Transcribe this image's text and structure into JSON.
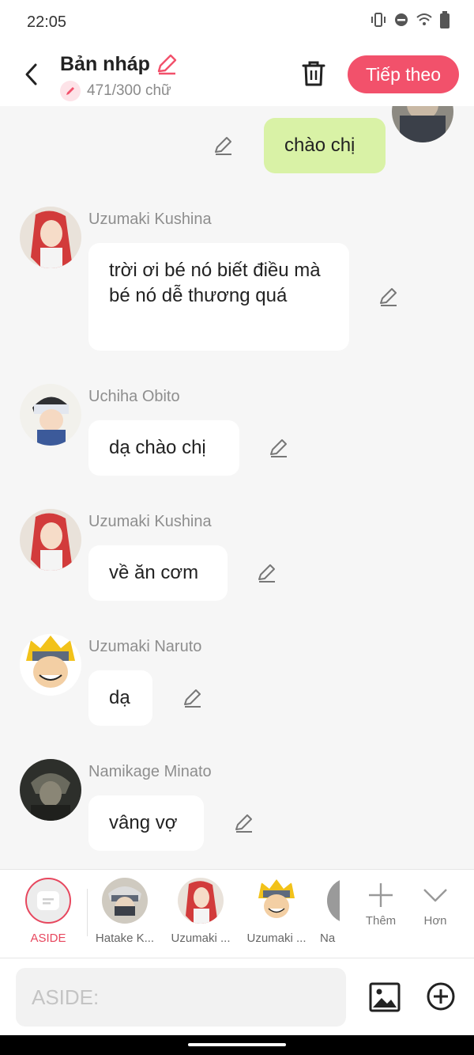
{
  "status": {
    "time": "22:05"
  },
  "header": {
    "title": "Bản nháp",
    "word_count": "471/300 chữ",
    "next_label": "Tiếp theo"
  },
  "messages": [
    {
      "from": "me",
      "text": "chào chị"
    },
    {
      "sender": "Uzumaki Kushina",
      "text": "trời ơi bé nó biết điều mà bé nó dễ thương quá"
    },
    {
      "sender": "Uchiha Obito",
      "text": "dạ chào chị"
    },
    {
      "sender": "Uzumaki Kushina",
      "text": "về ăn cơm"
    },
    {
      "sender": "Uzumaki Naruto",
      "text": "dạ"
    },
    {
      "sender": "Namikage Minato",
      "text": "vâng vợ"
    }
  ],
  "characters": [
    {
      "label": "ASIDE"
    },
    {
      "label": "Hatake K..."
    },
    {
      "label": "Uzumaki ..."
    },
    {
      "label": "Uzumaki ..."
    },
    {
      "label": "Na"
    }
  ],
  "tools": {
    "add_label": "Thêm",
    "more_label": "Hơn"
  },
  "composer": {
    "placeholder": "ASIDE:"
  },
  "colors": {
    "accent": "#f2516b",
    "my_bubble": "#d9f2a6",
    "background": "#f6f6f6"
  }
}
